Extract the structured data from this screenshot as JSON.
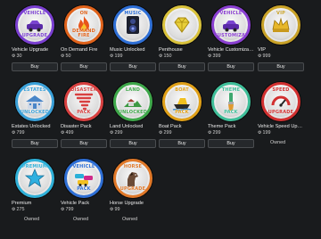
{
  "currency_icon": "robux-icon",
  "items": [
    {
      "name": "Vehicle Upgrade",
      "price": "30",
      "state": "buy",
      "badge_top": "VEHICLE",
      "badge_bottom": "UPGRADE",
      "icon": "car-icon",
      "ring": "#7a3fd1"
    },
    {
      "name": "On Demand Fire",
      "price": "50",
      "state": "buy",
      "badge_top": "ON",
      "badge_bottom": "DEMAND FIRE",
      "icon": "fire-icon",
      "ring": "#e0621a"
    },
    {
      "name": "Music Unlocked",
      "price": "199",
      "state": "buy",
      "badge_top": "MUSIC",
      "badge_bottom": "",
      "icon": "speaker-icon",
      "ring": "#2e6fd6"
    },
    {
      "name": "Penthouse",
      "price": "150",
      "state": "buy",
      "badge_top": "",
      "badge_bottom": "",
      "icon": "diamond-icon",
      "ring": "#d9c23b"
    },
    {
      "name": "Vehicle Customization",
      "price": "399",
      "state": "buy",
      "badge_top": "VEHICLE",
      "badge_bottom": "CUSTOMIZATION",
      "icon": "car-icon",
      "ring": "#8a3fd1"
    },
    {
      "name": "VIP",
      "price": "999",
      "state": "buy",
      "badge_top": "VIP",
      "badge_bottom": "",
      "icon": "crown-icon",
      "ring": "#c9a227"
    },
    {
      "name": "Estates Unlocked",
      "price": "799",
      "state": "buy",
      "badge_top": "ESTATES",
      "badge_bottom": "UNLOCKED",
      "icon": "mansion-icon",
      "ring": "#3aa0d8"
    },
    {
      "name": "Disaster Pack",
      "price": "499",
      "state": "buy",
      "badge_top": "DISASTER",
      "badge_bottom": "PACK",
      "icon": "tornado-icon",
      "ring": "#d84040"
    },
    {
      "name": "Land Unlocked",
      "price": "299",
      "state": "buy",
      "badge_top": "LAND",
      "badge_bottom": "UNLOCKED",
      "icon": "land-icon",
      "ring": "#3ea84a"
    },
    {
      "name": "Boat Pack",
      "price": "299",
      "state": "buy",
      "badge_top": "BOAT",
      "badge_bottom": "PACK",
      "icon": "boat-icon",
      "ring": "#e0a018"
    },
    {
      "name": "Theme Pack",
      "price": "299",
      "state": "buy",
      "badge_top": "THEME",
      "badge_bottom": "PACK",
      "icon": "paintbrush-icon",
      "ring": "#3fbf9a"
    },
    {
      "name": "Vehicle Speed Upgrade",
      "price": "199",
      "state": "owned",
      "badge_top": "SPEED",
      "badge_bottom": "UPGRADE",
      "icon": "speedometer-icon",
      "ring": "#d23030"
    },
    {
      "name": "Premium",
      "price": "275",
      "state": "owned",
      "badge_top": "PREMIUM",
      "badge_bottom": "",
      "icon": "star-icon",
      "ring": "#2fb0d8"
    },
    {
      "name": "Vehicle Pack",
      "price": "799",
      "state": "owned",
      "badge_top": "VEHICLE",
      "badge_bottom": "PACK",
      "icon": "cars-icon",
      "ring": "#2e6fd6"
    },
    {
      "name": "Horse Upgrade",
      "price": "99",
      "state": "owned",
      "badge_top": "HORSE",
      "badge_bottom": "UPGRADE",
      "icon": "horse-icon",
      "ring": "#e07828"
    }
  ],
  "labels": {
    "buy": "Buy",
    "owned": "Owned"
  }
}
